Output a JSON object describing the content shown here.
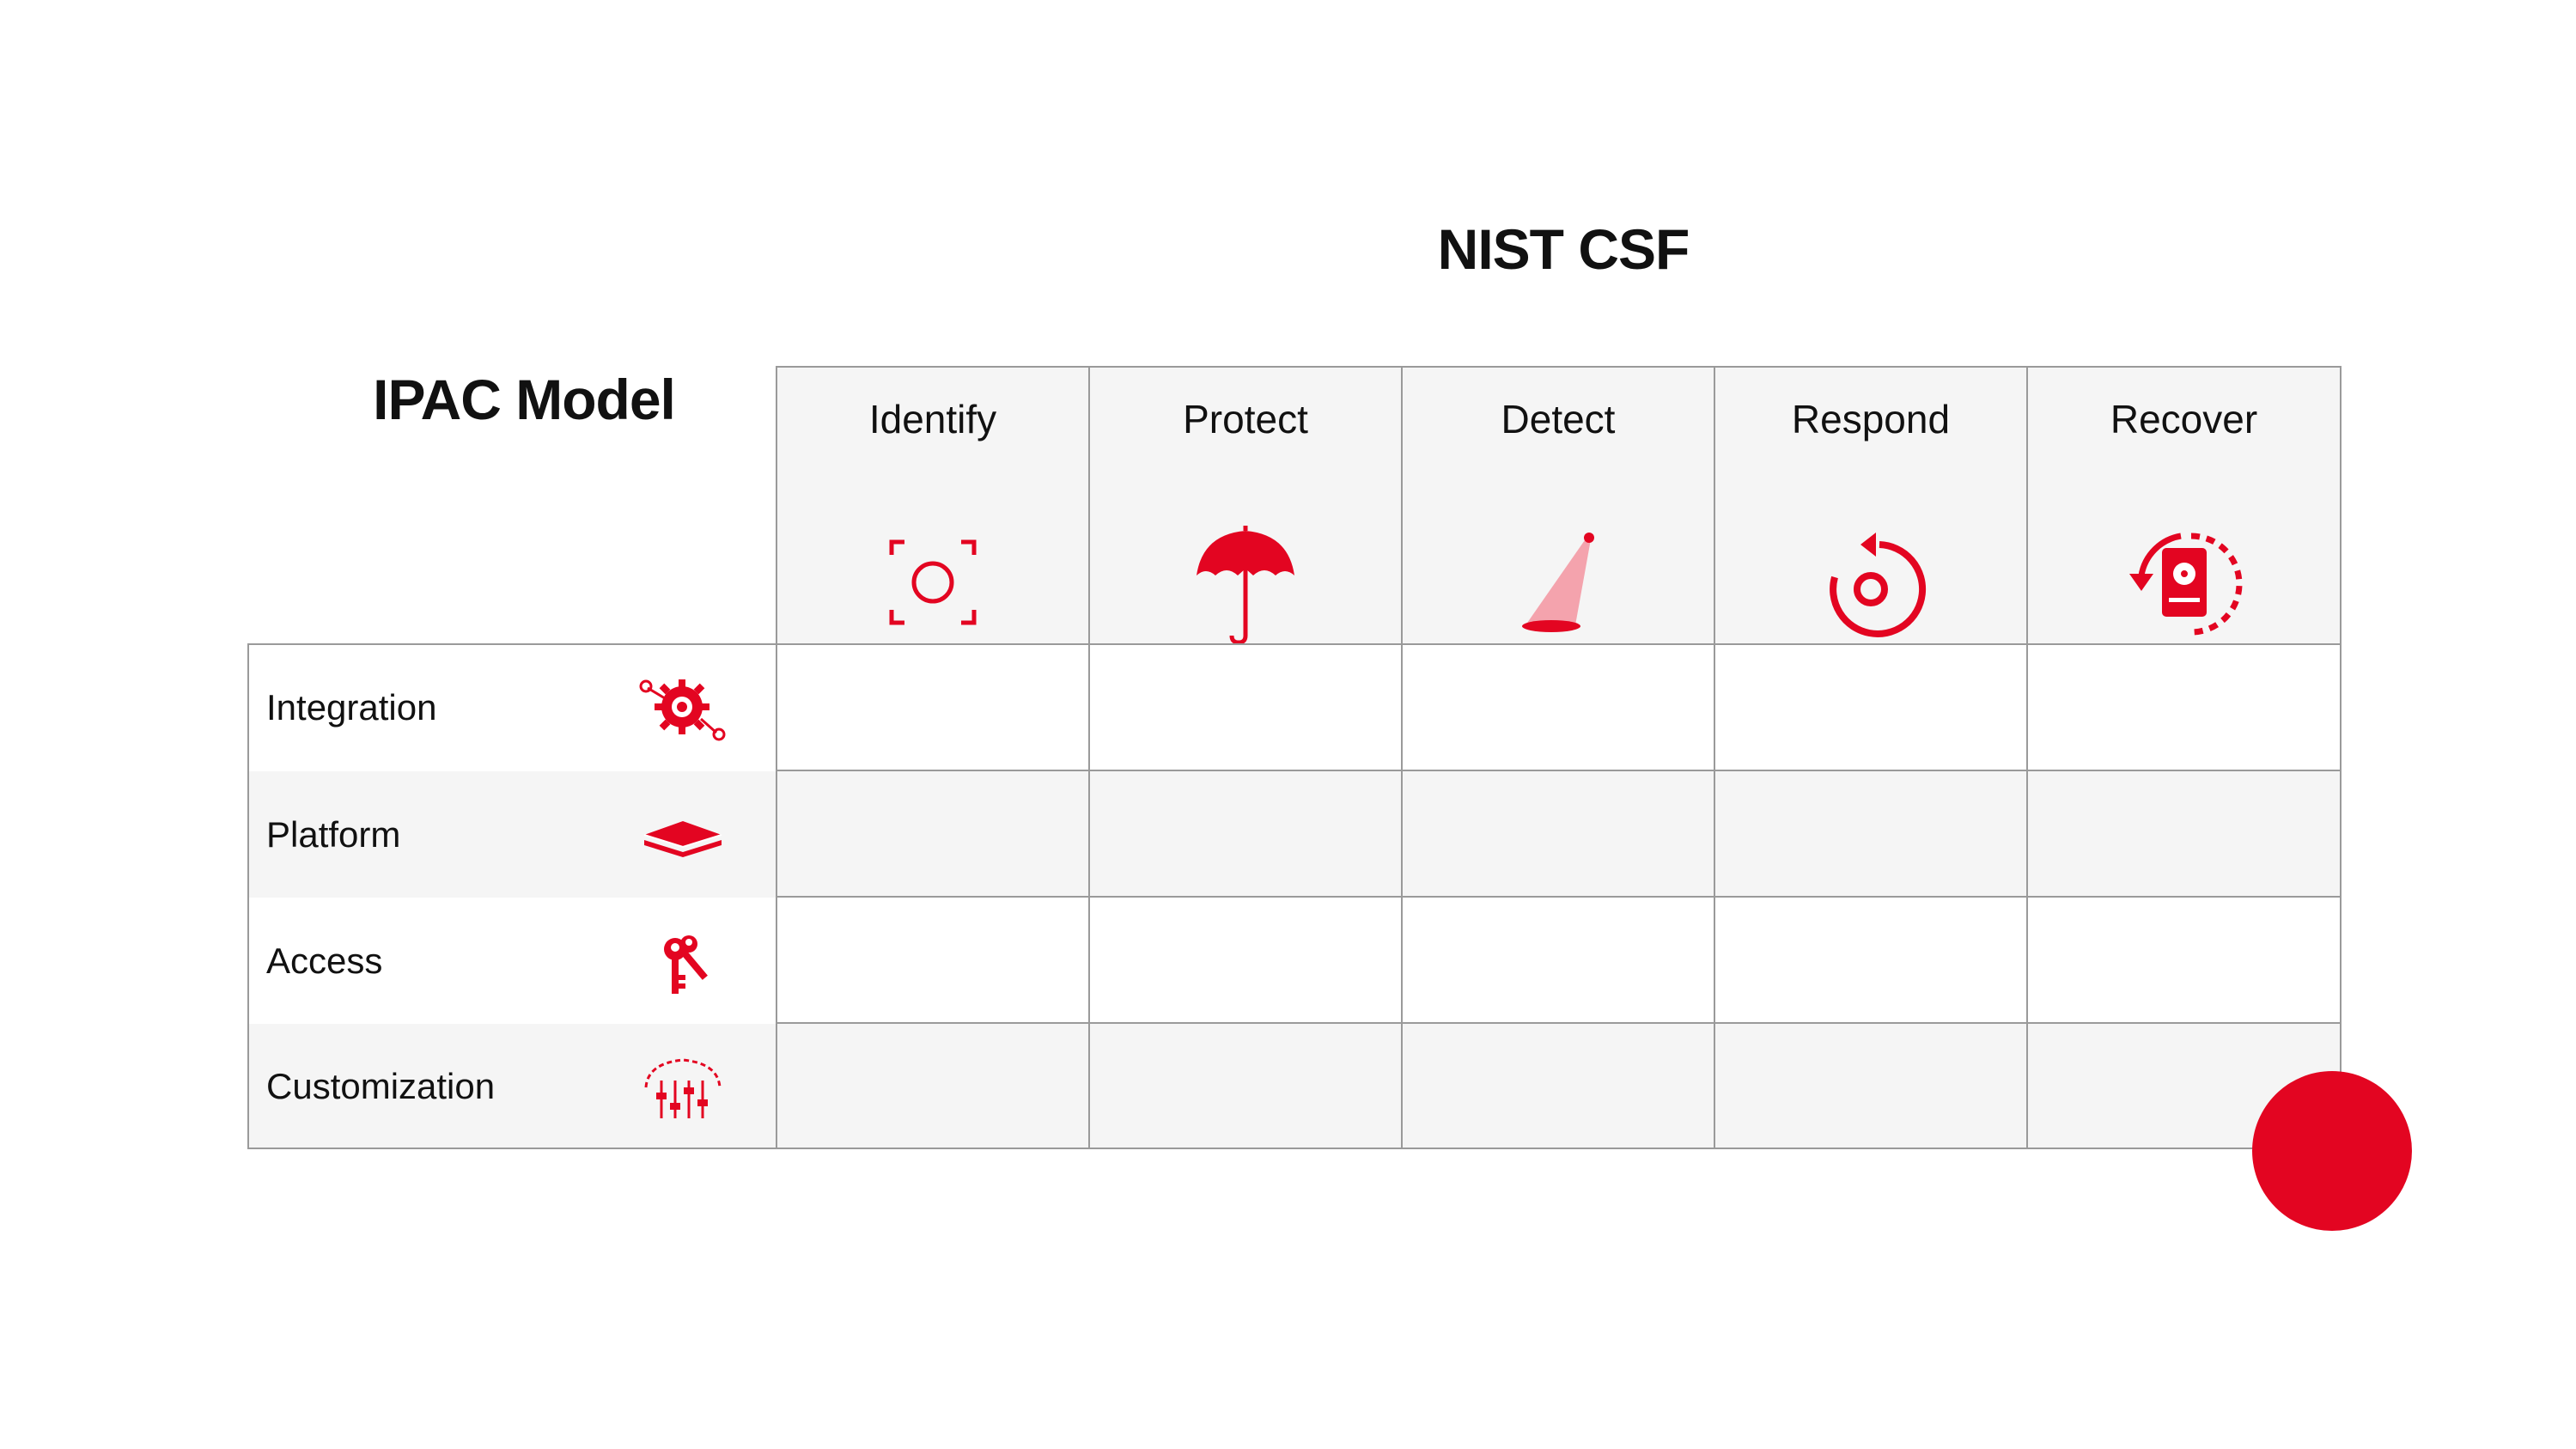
{
  "titles": {
    "nist": "NIST CSF",
    "ipac": "IPAC Model"
  },
  "columns": [
    {
      "label": "Identify",
      "icon": "identify-scan-icon"
    },
    {
      "label": "Protect",
      "icon": "umbrella-icon"
    },
    {
      "label": "Detect",
      "icon": "spotlight-icon"
    },
    {
      "label": "Respond",
      "icon": "respond-cycle-icon"
    },
    {
      "label": "Recover",
      "icon": "recover-drive-icon"
    }
  ],
  "rows": [
    {
      "label": "Integration",
      "icon": "gear-integration-icon"
    },
    {
      "label": "Platform",
      "icon": "layers-icon"
    },
    {
      "label": "Access",
      "icon": "keys-icon"
    },
    {
      "label": "Customization",
      "icon": "sliders-icon"
    }
  ],
  "colors": {
    "accent": "#e30521",
    "accent_light": "#f4a3ad",
    "header_bg": "#f5f5f5",
    "grid_line": "#9a9a9a"
  }
}
